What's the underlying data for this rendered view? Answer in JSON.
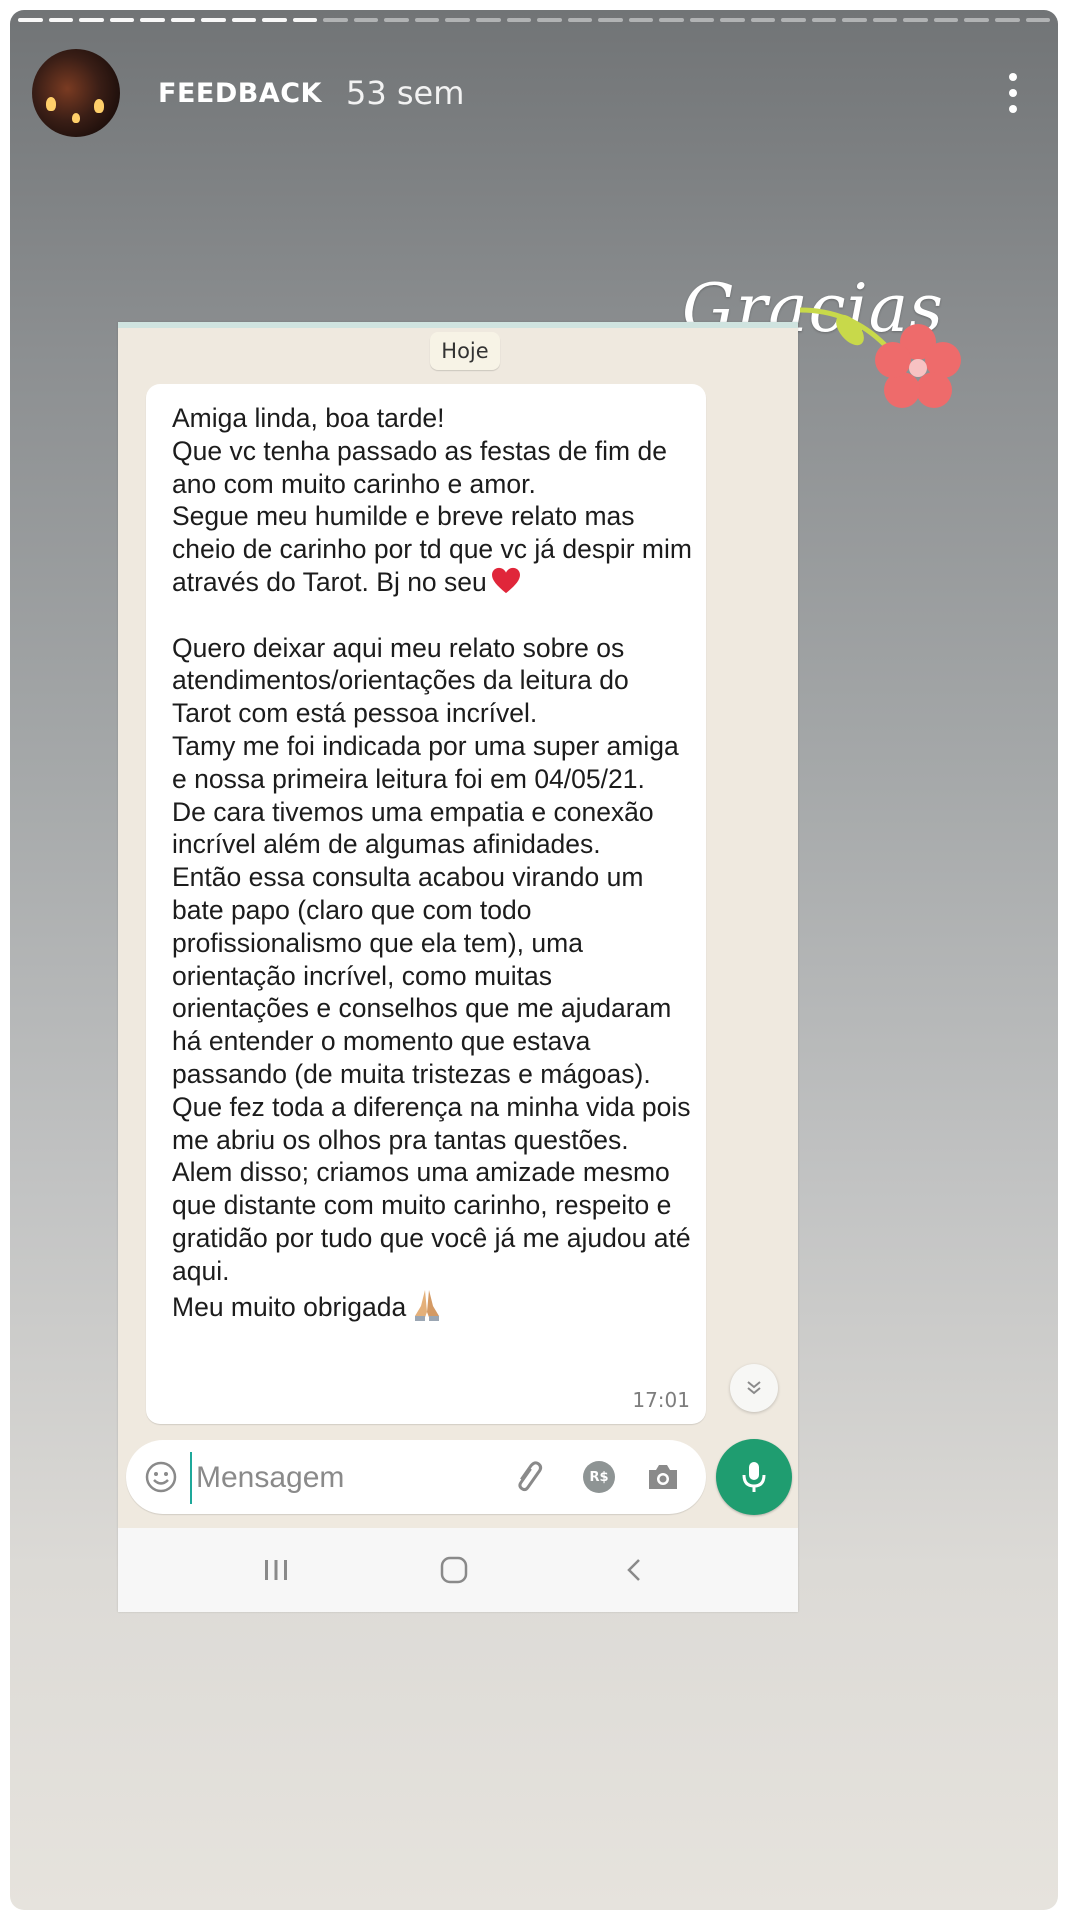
{
  "story": {
    "account_name": "FEEDBACK",
    "time_ago": "53 sem",
    "segments_total": 34,
    "segments_viewed": 10
  },
  "sticker": {
    "text": "Gracias"
  },
  "chat": {
    "date_label": "Hoje",
    "message_part1": "Amiga linda, boa tarde!\nQue vc tenha passado as festas de fim de ano com muito carinho e amor.\nSegue meu humilde e breve relato mas cheio de carinho por td que vc já despir mim através do Tarot. Bj no seu",
    "message_part2": "\n\nQuero deixar aqui meu relato sobre os atendimentos/orientações da leitura do Tarot com está pessoa incrível.\nTamy me foi indicada por uma super amiga e nossa primeira leitura foi em 04/05/21.\nDe cara tivemos uma empatia e conexão incrível além de algumas afinidades.\nEntão essa consulta acabou virando um bate papo (claro que com todo profissionalismo que ela tem), uma orientação incrível, como muitas orientações e conselhos que me ajudaram há entender o momento que estava passando (de muita tristezas e mágoas). Que fez toda a diferença na minha vida pois me abriu os olhos pra tantas questões. Alem disso; criamos uma amizade mesmo que distante com muito carinho, respeito e gratidão por tudo que você já me ajudou até aqui.\nMeu muito obrigada",
    "message_time": "17:01",
    "input_placeholder": "Mensagem",
    "pay_label": "R$"
  },
  "colors": {
    "accent_green": "#1f9d70",
    "heart_red": "#e0263a"
  }
}
